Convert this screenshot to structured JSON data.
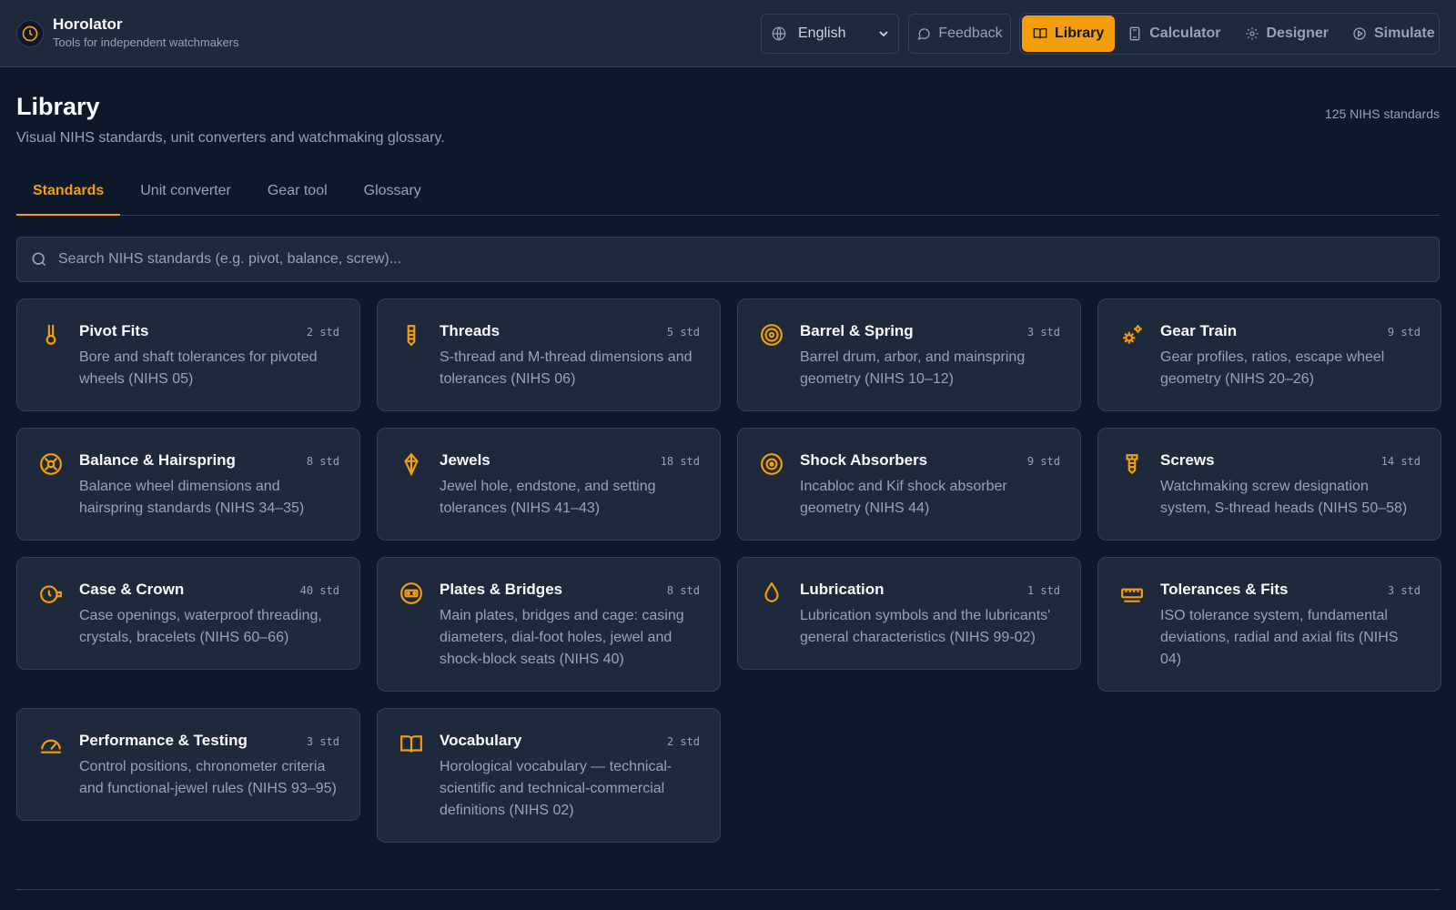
{
  "app": {
    "name": "Horolator",
    "tagline": "Tools for independent watchmakers"
  },
  "header": {
    "language": "English",
    "feedback_label": "Feedback",
    "nav": [
      {
        "label": "Library",
        "icon": "book-icon",
        "active": true
      },
      {
        "label": "Calculator",
        "icon": "calculator-icon",
        "active": false
      },
      {
        "label": "Designer",
        "icon": "gear-icon",
        "active": false
      },
      {
        "label": "Simulate",
        "icon": "play-icon",
        "active": false
      }
    ]
  },
  "page": {
    "title": "Library",
    "subtitle": "Visual NIHS standards, unit converters and watchmaking glossary.",
    "count_label": "125 NIHS standards"
  },
  "tabs": [
    {
      "label": "Standards",
      "active": true
    },
    {
      "label": "Unit converter",
      "active": false
    },
    {
      "label": "Gear tool",
      "active": false
    },
    {
      "label": "Glossary",
      "active": false
    }
  ],
  "search": {
    "placeholder": "Search NIHS standards (e.g. pivot, balance, screw)...",
    "value": ""
  },
  "colors": {
    "accent": "#f59e0b",
    "background": "#0f172a",
    "surface": "#1e293b",
    "border": "#334155"
  },
  "cards": [
    {
      "name": "Pivot Fits",
      "std": "2 std",
      "icon": "pivot-icon",
      "desc": "Bore and shaft tolerances for pivoted wheels (NIHS 05)"
    },
    {
      "name": "Threads",
      "std": "5 std",
      "icon": "thread-icon",
      "desc": "S-thread and M-thread dimensions and tolerances (NIHS 06)"
    },
    {
      "name": "Barrel & Spring",
      "std": "3 std",
      "icon": "barrel-icon",
      "desc": "Barrel drum, arbor, and mainspring geometry (NIHS 10–12)"
    },
    {
      "name": "Gear Train",
      "std": "9 std",
      "icon": "gears-icon",
      "desc": "Gear profiles, ratios, escape wheel geometry (NIHS 20–26)"
    },
    {
      "name": "Balance & Hairspring",
      "std": "8 std",
      "icon": "balance-icon",
      "desc": "Balance wheel dimensions and hairspring standards (NIHS 34–35)"
    },
    {
      "name": "Jewels",
      "std": "18 std",
      "icon": "jewel-icon",
      "desc": "Jewel hole, endstone, and setting tolerances (NIHS 41–43)"
    },
    {
      "name": "Shock Absorbers",
      "std": "9 std",
      "icon": "shock-icon",
      "desc": "Incabloc and Kif shock absorber geometry (NIHS 44)"
    },
    {
      "name": "Screws",
      "std": "14 std",
      "icon": "screw-icon",
      "desc": "Watchmaking screw designation system, S-thread heads (NIHS 50–58)"
    },
    {
      "name": "Case & Crown",
      "std": "40 std",
      "icon": "crown-icon",
      "desc": "Case openings, waterproof threading, crystals, bracelets (NIHS 60–66)"
    },
    {
      "name": "Plates & Bridges",
      "std": "8 std",
      "icon": "plate-icon",
      "desc": "Main plates, bridges and cage: casing diameters, dial-foot holes, jewel and shock-block seats (NIHS 40)"
    },
    {
      "name": "Lubrication",
      "std": "1 std",
      "icon": "droplet-icon",
      "desc": "Lubrication symbols and the lubricants' general characteristics (NIHS 99-02)"
    },
    {
      "name": "Tolerances & Fits",
      "std": "3 std",
      "icon": "ruler-icon",
      "desc": "ISO tolerance system, fundamental deviations, radial and axial fits (NIHS 04)"
    },
    {
      "name": "Performance & Testing",
      "std": "3 std",
      "icon": "gauge-icon",
      "desc": "Control positions, chronometer criteria and functional-jewel rules (NIHS 93–95)"
    },
    {
      "name": "Vocabulary",
      "std": "2 std",
      "icon": "book-open-icon",
      "desc": "Horological vocabulary — technical-scientific and technical-commercial definitions (NIHS 02)"
    }
  ]
}
